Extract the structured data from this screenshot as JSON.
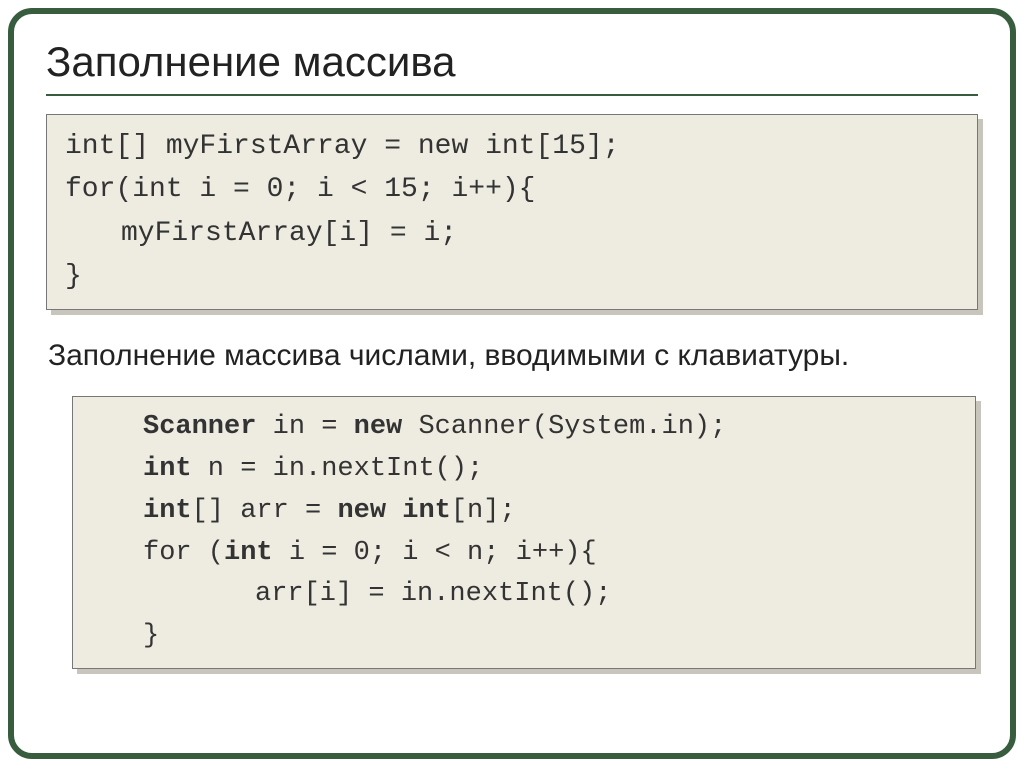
{
  "title": "Заполнение массива",
  "code1": {
    "line1": "int[] myFirstArray = new int[15];",
    "line2": "for(int i = 0; i < 15; i++){",
    "line3": "myFirstArray[i] = i;",
    "line4": "}"
  },
  "description": "Заполнение массива числами, вводимыми с клавиатуры.",
  "code2": {
    "line1a": "Scanner",
    "line1b": " in = ",
    "line1c": "new",
    "line1d": " Scanner(System.in);",
    "line2a": "int",
    "line2b": " n = in.nextInt();",
    "line3a": "int",
    "line3b": "[] arr = ",
    "line3c": "new",
    "line3d": " ",
    "line3e": "int",
    "line3f": "[n];",
    "line4a": "for (",
    "line4b": "int",
    "line4c": " i = 0; i < n; i++){",
    "line5": "arr[i] = in.nextInt();",
    "line6": "}"
  }
}
